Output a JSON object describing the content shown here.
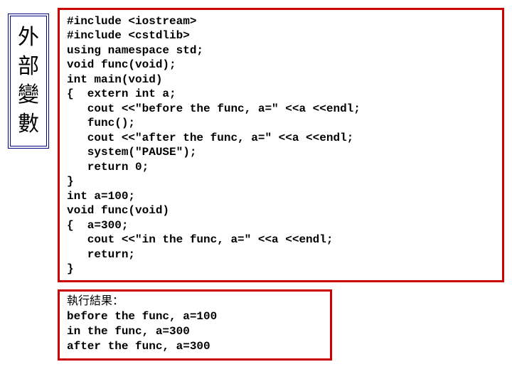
{
  "title": {
    "c1": "外",
    "c2": "部",
    "c3": "變",
    "c4": "數"
  },
  "code": {
    "l1": "#include <iostream>",
    "l2": "#include <cstdlib>",
    "l3": "using namespace std;",
    "l4": "void func(void);",
    "l5": "int main(void)",
    "l6": "{  extern int a;",
    "l7": "   cout <<\"before the func, a=\" <<a <<endl;",
    "l8": "   func();",
    "l9": "   cout <<\"after the func, a=\" <<a <<endl;",
    "l10": "   system(\"PAUSE\");",
    "l11": "   return 0;",
    "l12": "}",
    "l13": "int a=100;",
    "l14": "void func(void)",
    "l15": "{  a=300;",
    "l16": "   cout <<\"in the func, a=\" <<a <<endl;",
    "l17": "   return;",
    "l18": "}"
  },
  "result": {
    "label": "執行結果：",
    "r1": "before the func, a=100",
    "r2": "in the func, a=300",
    "r3": "after the func, a=300"
  }
}
